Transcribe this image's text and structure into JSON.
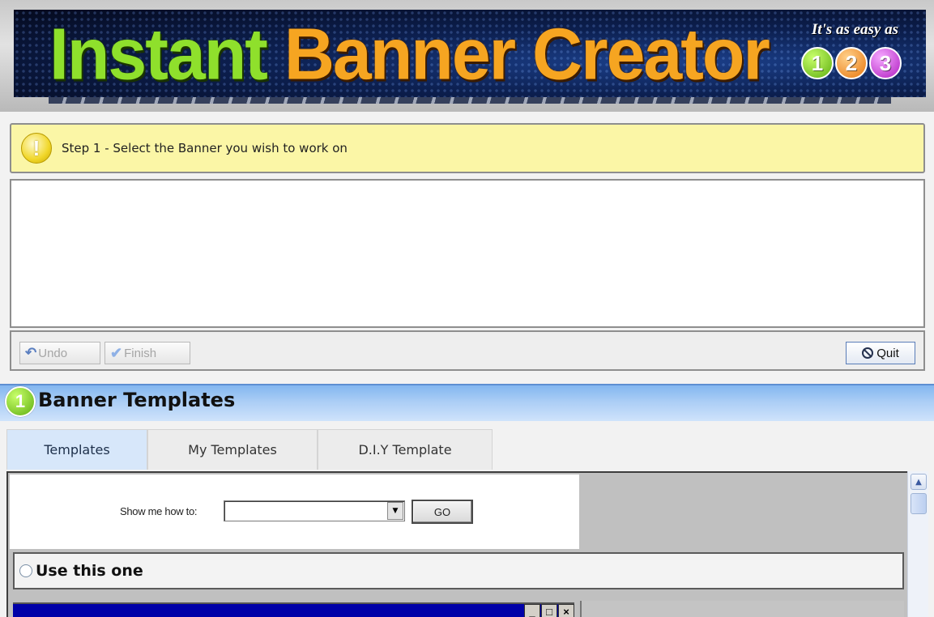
{
  "header": {
    "title_part1": "Instant",
    "title_part2": "Banner",
    "title_part3": "Creator",
    "tagline": "It's as easy as",
    "badges": [
      "1",
      "2",
      "3"
    ]
  },
  "step": {
    "icon_glyph": "!",
    "text": "Step 1 - Select the Banner you wish to work on"
  },
  "toolbar": {
    "undo_label": "Undo",
    "finish_label": "Finish",
    "quit_label": "Quit"
  },
  "templates": {
    "badge_number": "1",
    "title": "Banner Templates",
    "tabs": [
      {
        "label": "Templates",
        "active": true
      },
      {
        "label": "My Templates",
        "active": false
      },
      {
        "label": "D.I.Y Template",
        "active": false
      }
    ],
    "show_me_label": "Show me how to:",
    "show_me_value": "",
    "go_label": "GO",
    "use_label": "Use this one",
    "window_controls": [
      "_",
      "□",
      "×"
    ]
  },
  "colors": {
    "step_bg": "#fbf6a6",
    "header_blue": "#0c1f4f",
    "title_green": "#8fe02c",
    "title_orange": "#f6a521",
    "templates_bar": "#a9ccf5",
    "preview_blue": "#0000a8"
  },
  "icons": {
    "warning": "warning-icon",
    "undo": "undo-icon",
    "finish": "checkmark-icon",
    "quit": "quit-icon",
    "dropdown": "chevron-down-icon",
    "scroll_up": "scroll-up-icon"
  }
}
